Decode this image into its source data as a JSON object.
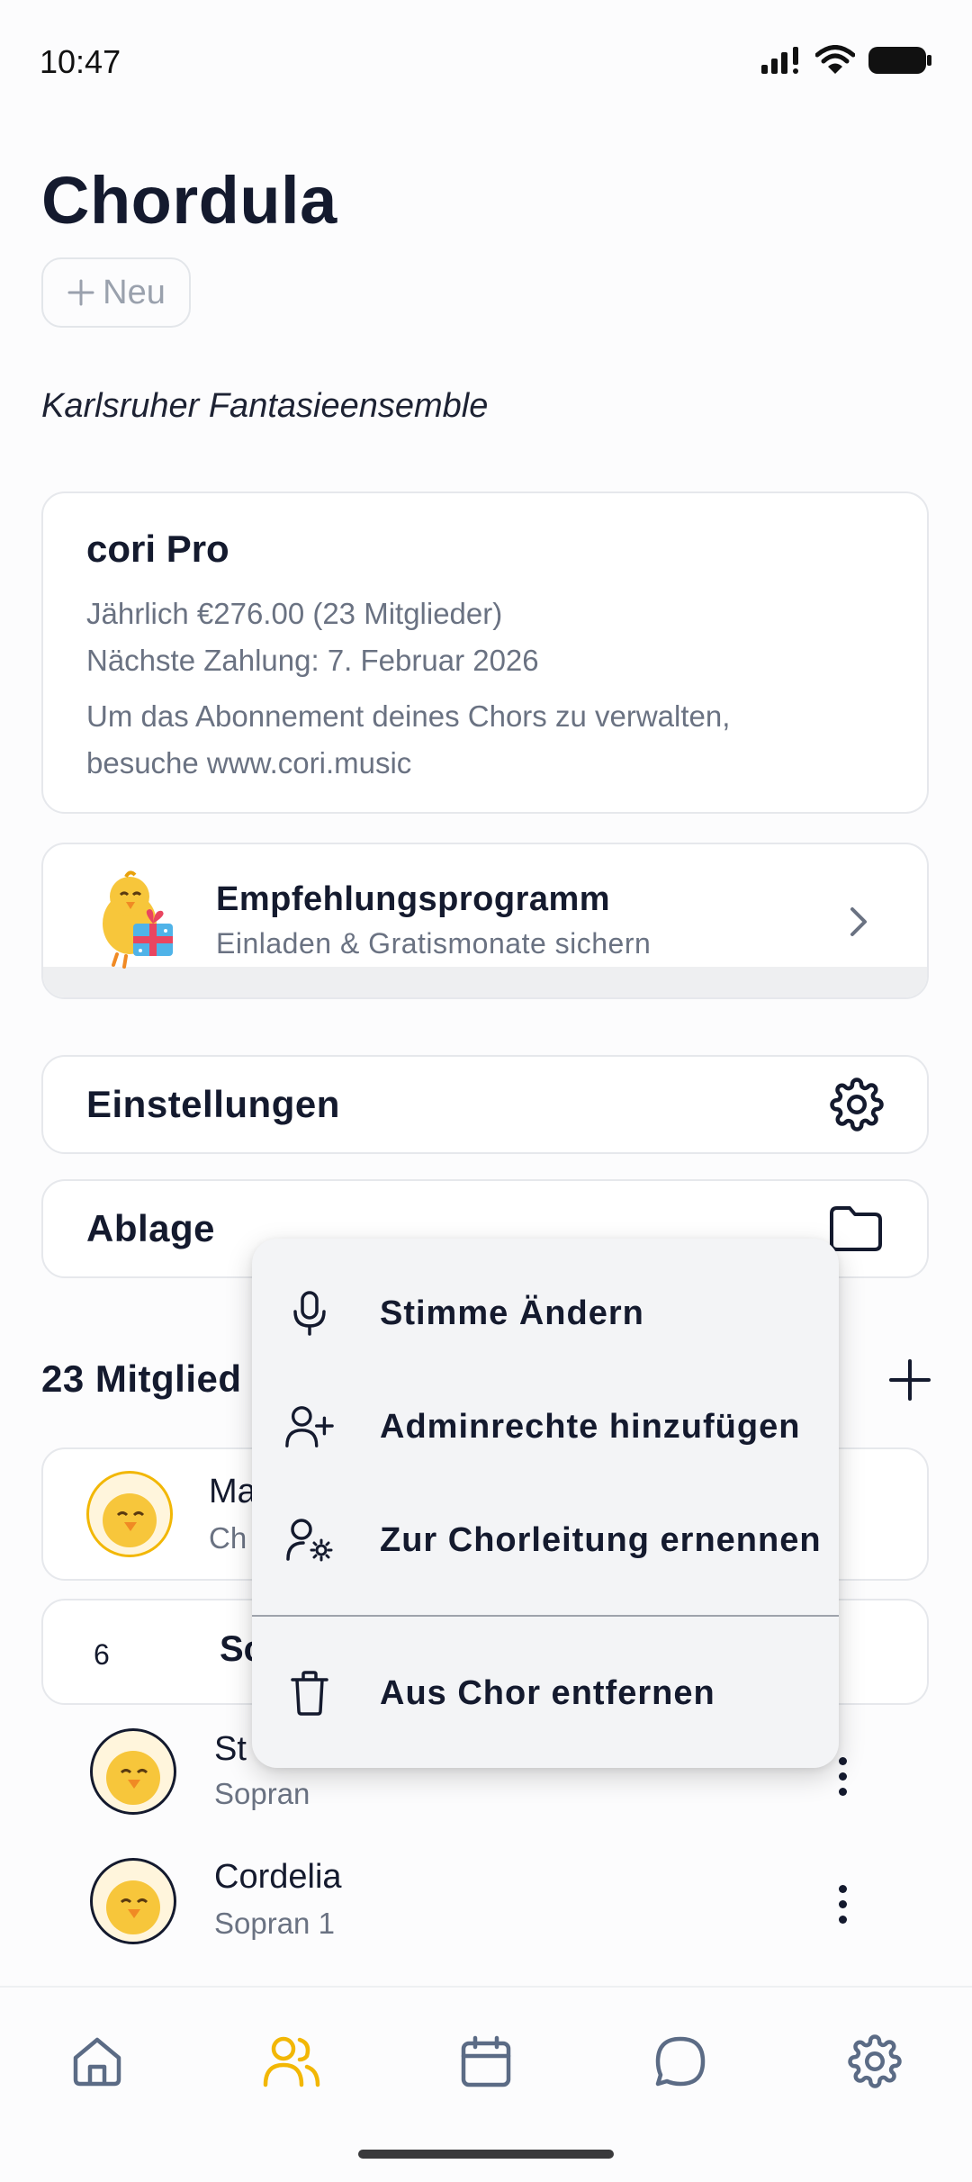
{
  "status_bar": {
    "time": "10:47"
  },
  "header": {
    "title": "Chordula",
    "new_button_label": "Neu"
  },
  "choir_name": "Karlsruher Fantasieensemble",
  "subscription": {
    "title": "cori Pro",
    "price_line": "Jährlich €276.00 (23 Mitglieder)",
    "next_payment": "Nächste Zahlung: 7. Februar 2026",
    "note_line1": "Um das Abonnement deines Chors zu verwalten,",
    "note_line2": "besuche www.cori.music"
  },
  "referral": {
    "title": "Empfehlungsprogramm",
    "subtitle": "Einladen & Gratismonate sichern"
  },
  "settings_row": {
    "label": "Einstellungen"
  },
  "storage_row": {
    "label": "Ablage"
  },
  "members": {
    "title_visible": "23 Mitglied",
    "first_member": {
      "name_visible": "Ma",
      "role_visible": "Ch"
    },
    "group": {
      "count": "6",
      "name_visible": "Sc"
    },
    "list": [
      {
        "name_visible": "St",
        "role": "Sopran"
      },
      {
        "name": "Cordelia",
        "role": "Sopran 1"
      }
    ]
  },
  "context_menu": {
    "items": [
      {
        "label": "Stimme Ändern",
        "icon": "microphone-icon"
      },
      {
        "label": "Adminrechte hinzufügen",
        "icon": "user-plus-icon"
      },
      {
        "label": "Zur Chorleitung ernennen",
        "icon": "user-cog-icon"
      },
      {
        "label": "Aus Chor entfernen",
        "icon": "trash-icon"
      }
    ]
  },
  "bottom_nav": {
    "items": [
      {
        "icon": "home-icon",
        "active": false
      },
      {
        "icon": "members-icon",
        "active": true
      },
      {
        "icon": "calendar-icon",
        "active": false
      },
      {
        "icon": "chat-icon",
        "active": false
      },
      {
        "icon": "settings-icon",
        "active": false
      }
    ]
  },
  "colors": {
    "accent": "#f2b705",
    "text_primary": "#141a2e",
    "text_secondary": "#6a7282",
    "icon_default": "#5b6b85"
  }
}
